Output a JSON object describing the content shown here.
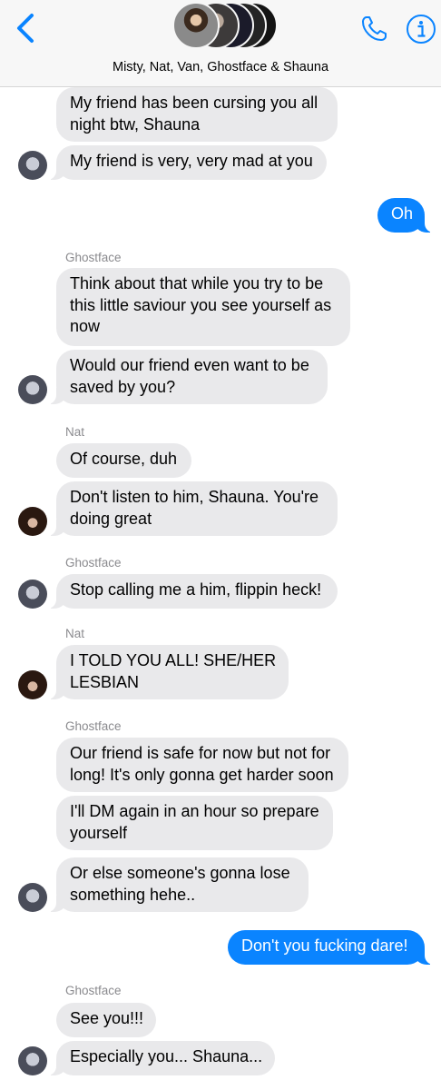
{
  "header": {
    "title": "Misty, Nat, Van, Ghostface & Shauna"
  },
  "colors": {
    "outgoing": "#0a84ff",
    "incoming": "#e9e9eb",
    "accent": "#0a84ff"
  },
  "messages": [
    {
      "dir": "in",
      "lines": [
        "My friend has been cursing you all",
        "night btw, Shauna"
      ]
    },
    {
      "dir": "in",
      "lines": [
        "My friend is very, very mad at you"
      ],
      "avatar": "ghost"
    },
    {
      "dir": "out",
      "lines": [
        "Oh"
      ]
    },
    {
      "sender": "Ghostface"
    },
    {
      "dir": "in",
      "lines": [
        "Think about that while you try to be",
        "this little saviour you see yourself as",
        "now"
      ]
    },
    {
      "dir": "in",
      "lines": [
        "Would our friend even want to be",
        "saved by you?"
      ],
      "avatar": "ghost"
    },
    {
      "sender": "Nat"
    },
    {
      "dir": "in",
      "lines": [
        "Of course, duh"
      ]
    },
    {
      "dir": "in",
      "lines": [
        "Don't listen to him, Shauna. You're",
        "doing great"
      ],
      "avatar": "nat"
    },
    {
      "sender": "Ghostface"
    },
    {
      "dir": "in",
      "lines": [
        "Stop calling me a him, flippin heck!"
      ],
      "avatar": "ghost"
    },
    {
      "sender": "Nat"
    },
    {
      "dir": "in",
      "lines": [
        "I TOLD YOU ALL! SHE/HER",
        "LESBIAN"
      ],
      "avatar": "nat"
    },
    {
      "sender": "Ghostface"
    },
    {
      "dir": "in",
      "lines": [
        "Our friend is safe for now but not for",
        "long! It's only gonna get harder soon"
      ]
    },
    {
      "dir": "in",
      "lines": [
        "I'll DM again in an hour so prepare",
        "yourself"
      ]
    },
    {
      "dir": "in",
      "lines": [
        "Or else someone's gonna lose",
        "something hehe.."
      ],
      "avatar": "ghost"
    },
    {
      "dir": "out",
      "lines": [
        "Don't you fucking dare!"
      ]
    },
    {
      "sender": "Ghostface"
    },
    {
      "dir": "in",
      "lines": [
        "See you!!!"
      ]
    },
    {
      "dir": "in",
      "lines": [
        "Especially you... Shauna..."
      ],
      "avatar": "ghost"
    }
  ]
}
